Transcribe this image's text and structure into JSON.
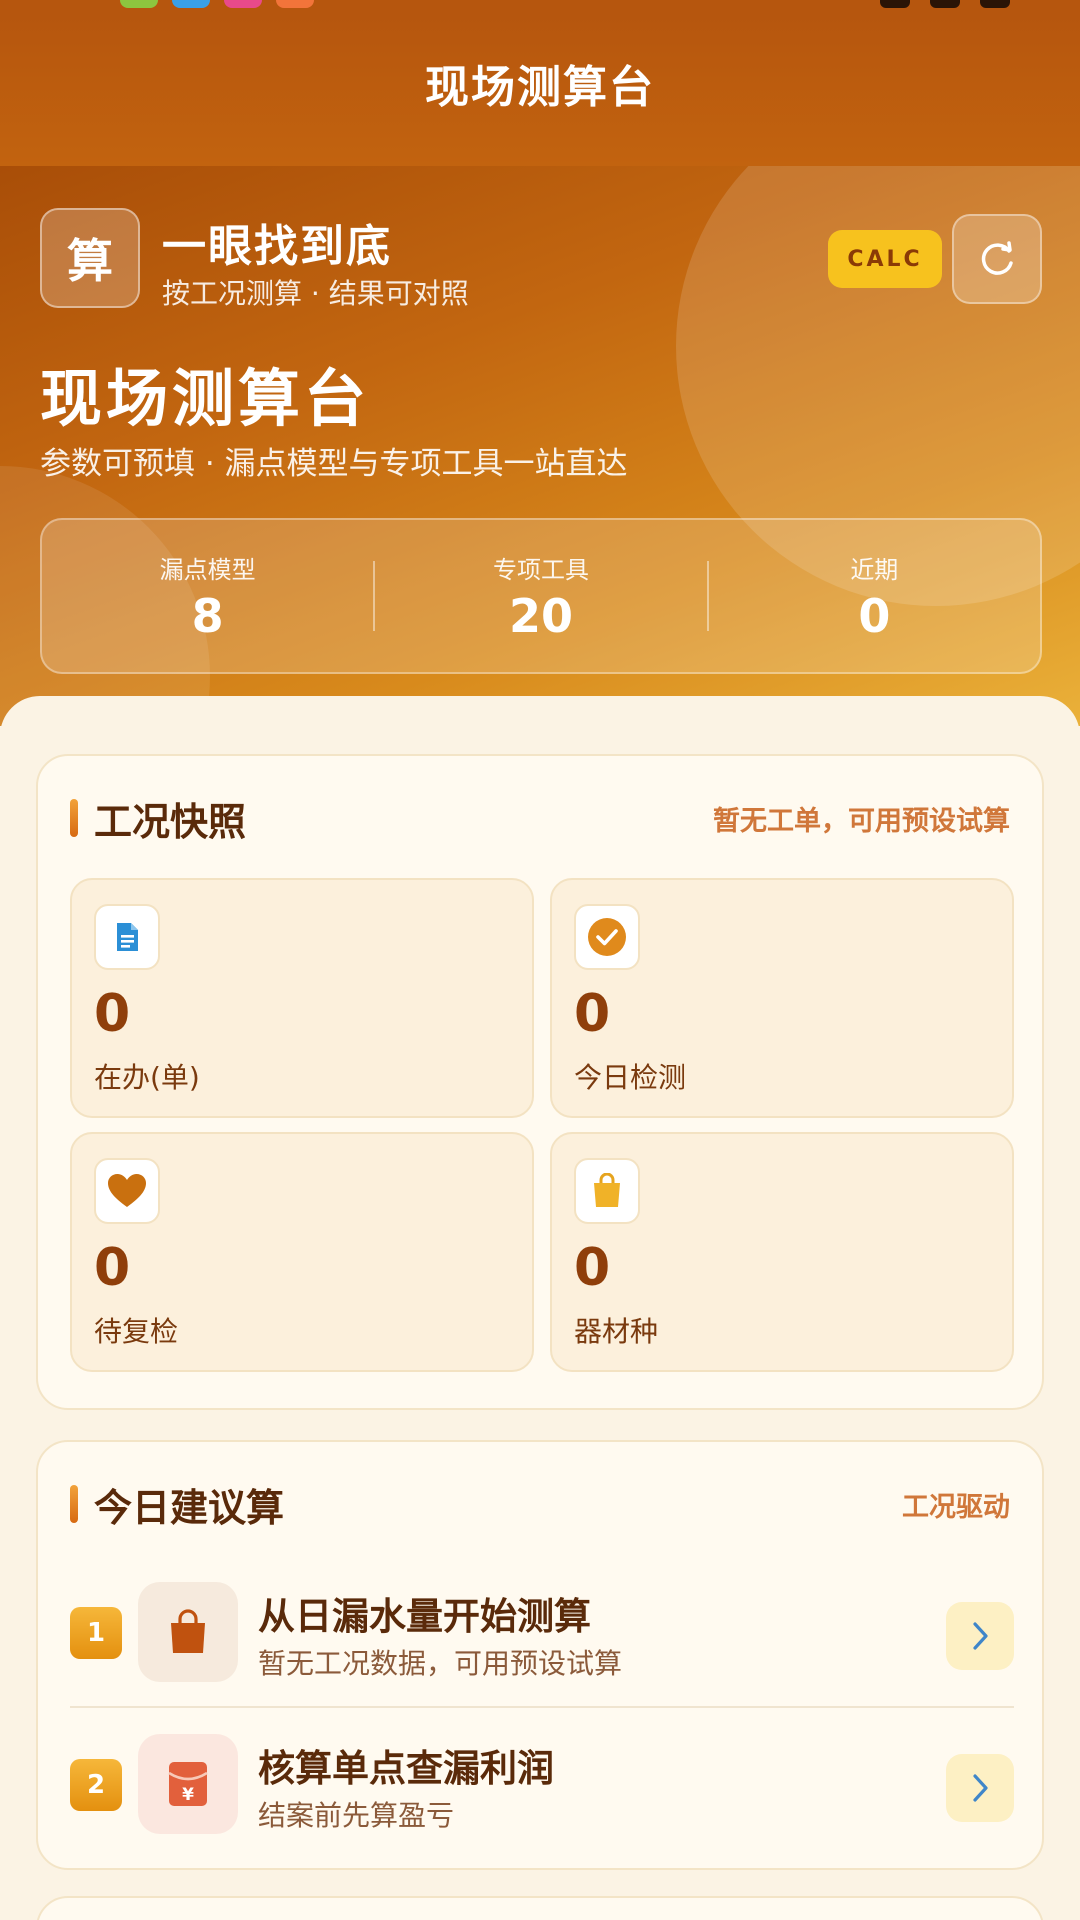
{
  "nav": {
    "title": "现场测算台"
  },
  "hero": {
    "logo_char": "算",
    "brand_name": "一眼找到底",
    "brand_sub": "按工况测算 · 结果可对照",
    "calc_badge": "CALC",
    "title": "现场测算台",
    "subtitle": "参数可预填 · 漏点模型与专项工具一站直达",
    "stats": [
      {
        "label": "漏点模型",
        "value": "8"
      },
      {
        "label": "专项工具",
        "value": "20"
      },
      {
        "label": "近期",
        "value": "0"
      }
    ]
  },
  "snapshot": {
    "title": "工况快照",
    "hint": "暂无工单，可用预设试算",
    "tiles": [
      {
        "icon": "document-icon",
        "value": "0",
        "label": "在办(单)"
      },
      {
        "icon": "check-circle-icon",
        "value": "0",
        "label": "今日检测"
      },
      {
        "icon": "heart-icon",
        "value": "0",
        "label": "待复检"
      },
      {
        "icon": "bag-icon",
        "value": "0",
        "label": "器材种"
      }
    ]
  },
  "suggest": {
    "title": "今日建议算",
    "hint": "工况驱动",
    "items": [
      {
        "num": "1",
        "icon": "shopping-bag-icon",
        "title": "从日漏水量开始测算",
        "sub": "暂无工况数据，可用预设试算"
      },
      {
        "num": "2",
        "icon": "red-envelope-yen-icon",
        "title": "核算单点查漏利润",
        "sub": "结案前先算盈亏"
      }
    ]
  },
  "colors": {
    "brand": "#b6560e",
    "accent_yellow": "#f7c21e",
    "hint_orange": "#d0773a",
    "value_brown": "#8f3f0b"
  }
}
